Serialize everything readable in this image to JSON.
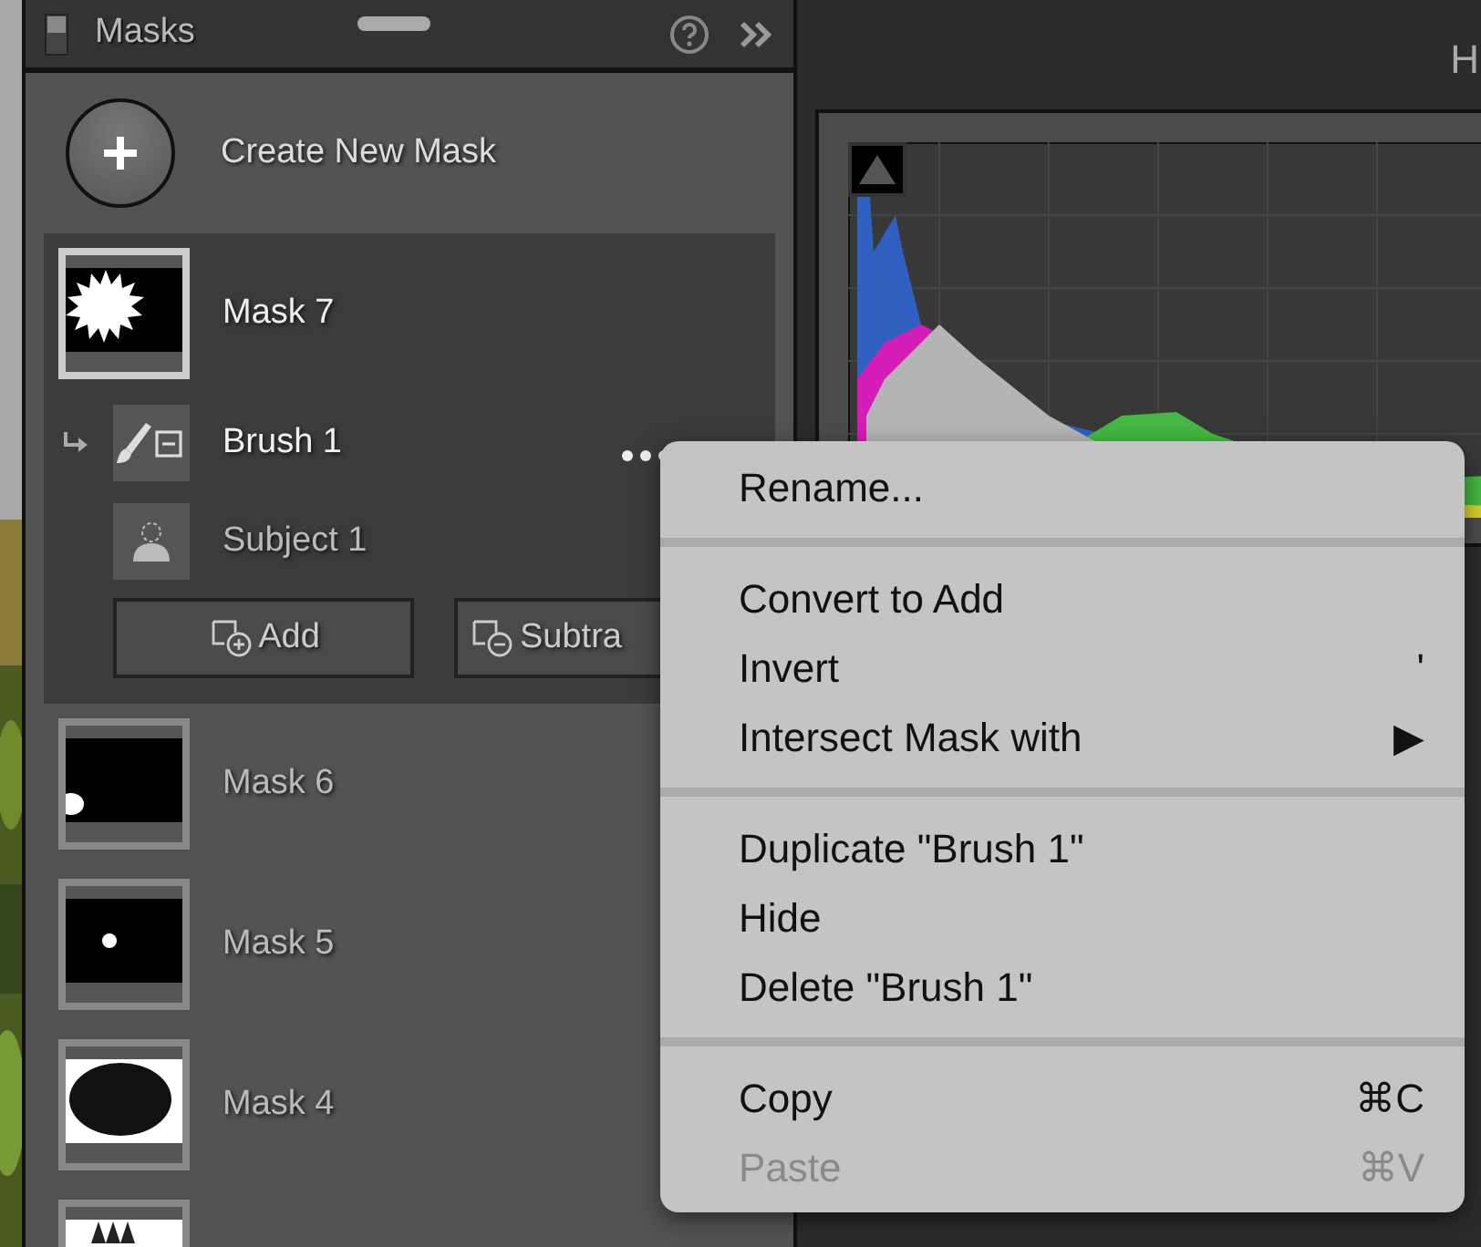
{
  "panel": {
    "title": "Masks",
    "create_label": "Create New Mask",
    "masks": [
      {
        "name": "Mask 7",
        "kind": "burst",
        "selected": true,
        "components": [
          {
            "name": "Brush 1",
            "kind": "brush",
            "selected": true
          },
          {
            "name": "Subject 1",
            "kind": "subject",
            "selected": false
          }
        ],
        "buttons": [
          {
            "label": "Add",
            "kind": "add"
          },
          {
            "label": "Subtra",
            "kind": "subtract"
          }
        ]
      },
      {
        "name": "Mask 6",
        "kind": "corner",
        "selected": false
      },
      {
        "name": "Mask 5",
        "kind": "dot",
        "selected": false
      },
      {
        "name": "Mask 4",
        "kind": "ellipse",
        "selected": false
      },
      {
        "kind": "spiky",
        "selected": false
      }
    ]
  },
  "right_panel": {
    "heading": "H"
  },
  "context_menu": {
    "groups": [
      [
        {
          "label": "Rename...",
          "disabled": false
        }
      ],
      [
        {
          "label": "Convert to Add",
          "disabled": false
        },
        {
          "label": "Invert",
          "shortcut": "'",
          "disabled": false
        },
        {
          "label": "Intersect Mask with",
          "submenu": "▶",
          "disabled": false
        }
      ],
      [
        {
          "label": "Duplicate \"Brush 1\"",
          "disabled": false
        },
        {
          "label": "Hide",
          "disabled": false
        },
        {
          "label": "Delete \"Brush 1\"",
          "disabled": false
        }
      ],
      [
        {
          "label": "Copy",
          "shortcut": "⌘C",
          "disabled": false
        },
        {
          "label": "Paste",
          "shortcut": "⌘V",
          "disabled": true
        }
      ]
    ]
  }
}
